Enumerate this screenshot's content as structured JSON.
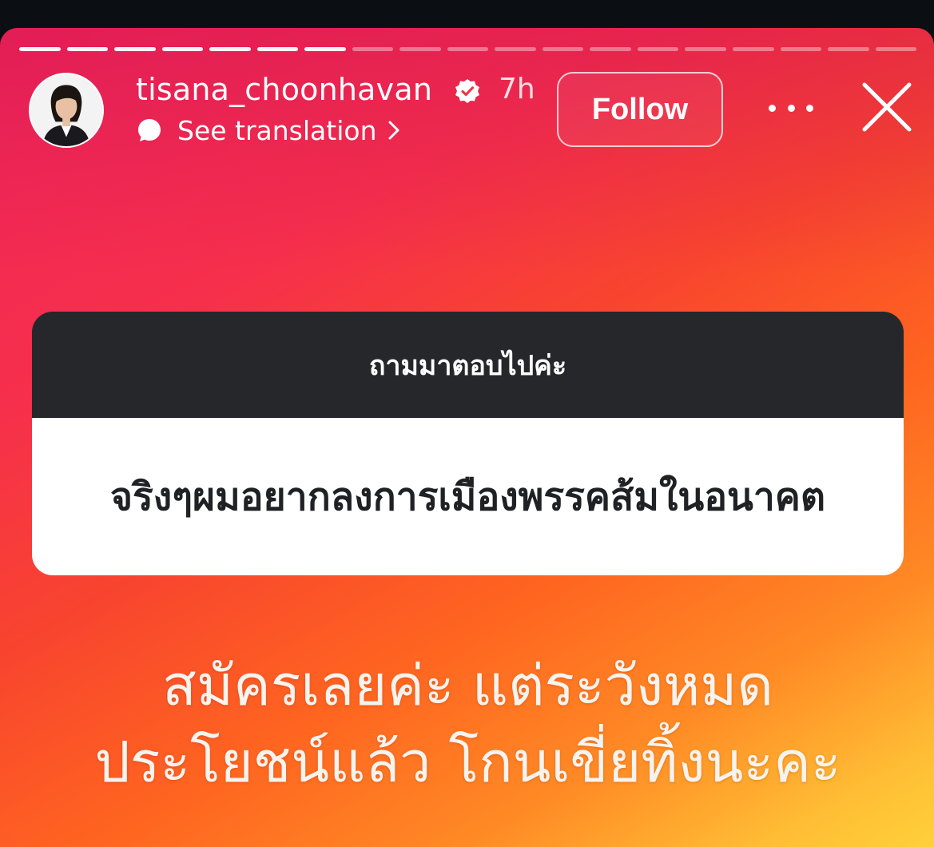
{
  "story": {
    "progress_total": 19,
    "progress_done": 7,
    "author": {
      "username": "tisana_choonhavan",
      "verified": true,
      "time_ago": "7h",
      "avatar_icon": "profile-photo"
    },
    "translation": {
      "label": "See translation",
      "icon": "speech-bubble-icon"
    },
    "actions": {
      "follow_label": "Follow",
      "more_icon": "more-horizontal-icon",
      "close_icon": "close-icon"
    },
    "question_sticker": {
      "prompt": "ถามมาตอบไปค่ะ",
      "question": "จริงๆผมอยากลงการเมืองพรรคส้มในอนาคต"
    },
    "answer": {
      "line1": "สมัครเลยค่ะ แต่ระวังหมด",
      "line2": "ประโยชน์แล้ว โกนเขี่ยทิ้งนะคะ"
    }
  }
}
